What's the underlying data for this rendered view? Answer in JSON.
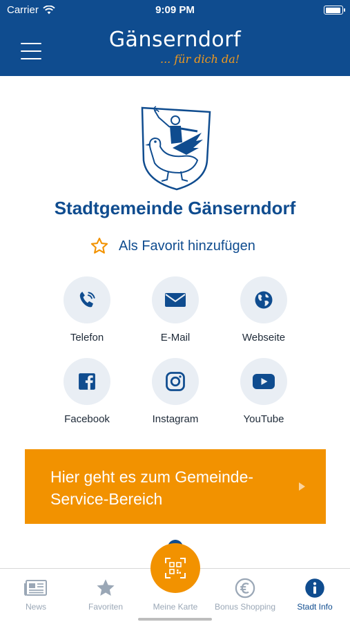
{
  "status_bar": {
    "carrier": "Carrier",
    "time": "9:09 PM",
    "wifi_icon": "wifi-icon",
    "battery_icon": "battery-icon"
  },
  "header": {
    "menu_icon": "hamburger-menu-icon",
    "logo_title": "Gänserndorf",
    "logo_tagline": "... für dich da!"
  },
  "colors": {
    "brand_blue": "#0f4c8f",
    "accent_orange": "#f29200",
    "icon_circle_bg": "#e9eef4",
    "inactive_tab": "#9aa7b6"
  },
  "org": {
    "crest_icon": "coat-of-arms-icon",
    "title": "Stadtgemeinde Gänserndorf",
    "favorite_label": "Als Favorit hinzufügen",
    "favorite_icon": "star-outline-icon"
  },
  "contacts": [
    {
      "label": "Telefon",
      "icon": "phone-icon"
    },
    {
      "label": "E-Mail",
      "icon": "envelope-icon"
    },
    {
      "label": "Webseite",
      "icon": "globe-icon"
    },
    {
      "label": "Facebook",
      "icon": "facebook-icon"
    },
    {
      "label": "Instagram",
      "icon": "instagram-icon"
    },
    {
      "label": "YouTube",
      "icon": "youtube-icon"
    }
  ],
  "service_button": {
    "label": "Hier geht es zum Gemeinde-Service-Bereich",
    "icon": "chevron-right-icon"
  },
  "tabbar": {
    "active": "Stadt Info",
    "tabs": [
      {
        "label": "News",
        "icon": "newspaper-icon"
      },
      {
        "label": "Favoriten",
        "icon": "star-icon"
      },
      {
        "label": "Meine Karte",
        "icon": "qr-scan-icon"
      },
      {
        "label": "Bonus Shopping",
        "icon": "euro-icon"
      },
      {
        "label": "Stadt Info",
        "icon": "info-icon"
      }
    ]
  }
}
